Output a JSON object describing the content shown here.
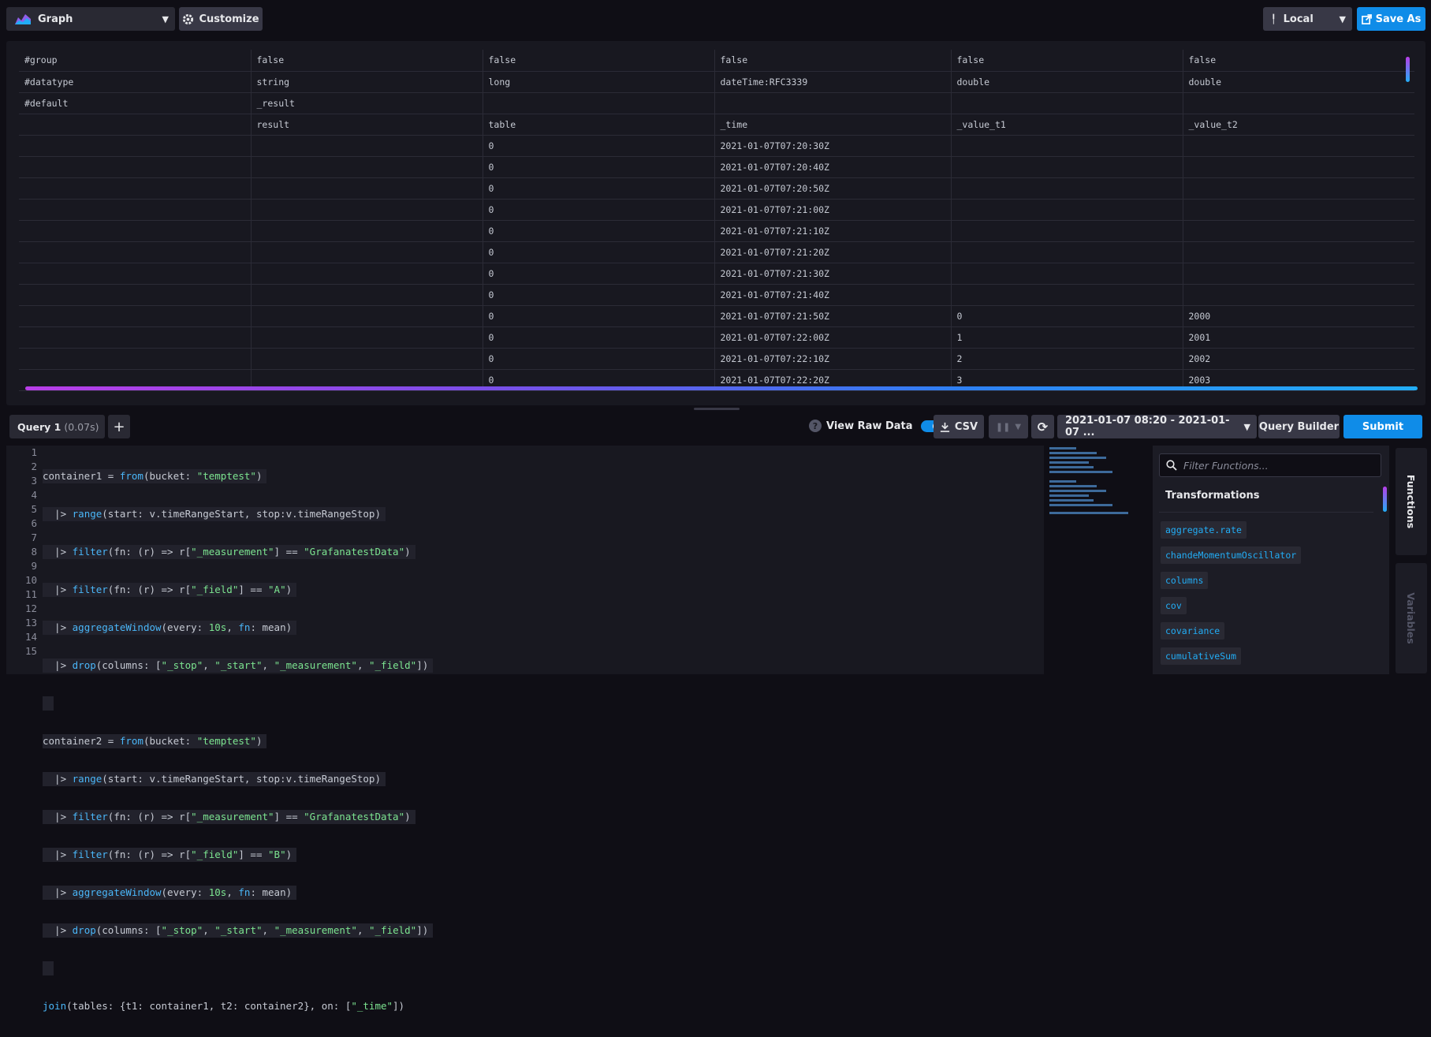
{
  "toolbar": {
    "vis_type": "Graph",
    "customize_label": "Customize",
    "timezone": "Local",
    "save_as_label": "Save As"
  },
  "raw_table": {
    "rows": [
      [
        "#group",
        "false",
        "false",
        "false",
        "false",
        "false"
      ],
      [
        "#datatype",
        "string",
        "long",
        "dateTime:RFC3339",
        "double",
        "double"
      ],
      [
        "#default",
        "_result",
        "",
        "",
        "",
        ""
      ],
      [
        "",
        "result",
        "table",
        "_time",
        "_value_t1",
        "_value_t2"
      ],
      [
        "",
        "",
        "0",
        "2021-01-07T07:20:30Z",
        "",
        ""
      ],
      [
        "",
        "",
        "0",
        "2021-01-07T07:20:40Z",
        "",
        ""
      ],
      [
        "",
        "",
        "0",
        "2021-01-07T07:20:50Z",
        "",
        ""
      ],
      [
        "",
        "",
        "0",
        "2021-01-07T07:21:00Z",
        "",
        ""
      ],
      [
        "",
        "",
        "0",
        "2021-01-07T07:21:10Z",
        "",
        ""
      ],
      [
        "",
        "",
        "0",
        "2021-01-07T07:21:20Z",
        "",
        ""
      ],
      [
        "",
        "",
        "0",
        "2021-01-07T07:21:30Z",
        "",
        ""
      ],
      [
        "",
        "",
        "0",
        "2021-01-07T07:21:40Z",
        "",
        ""
      ],
      [
        "",
        "",
        "0",
        "2021-01-07T07:21:50Z",
        "0",
        "2000"
      ],
      [
        "",
        "",
        "0",
        "2021-01-07T07:22:00Z",
        "1",
        "2001"
      ],
      [
        "",
        "",
        "0",
        "2021-01-07T07:22:10Z",
        "2",
        "2002"
      ],
      [
        "",
        "",
        "0",
        "2021-01-07T07:22:20Z",
        "3",
        "2003"
      ]
    ]
  },
  "query_bar": {
    "tab_label": "Query 1",
    "tab_time": "(0.07s)",
    "add_label": "+",
    "view_raw_label": "View Raw Data",
    "csv_label": "CSV",
    "time_range": "2021-01-07 08:20 - 2021-01-07 ...",
    "query_builder_label": "Query Builder",
    "submit_label": "Submit"
  },
  "editor": {
    "line_numbers": [
      "1",
      "2",
      "3",
      "4",
      "5",
      "6",
      "7",
      "8",
      "9",
      "10",
      "11",
      "12",
      "13",
      "14",
      "15"
    ]
  },
  "functions_panel": {
    "filter_placeholder": "Filter Functions...",
    "section_title": "Transformations",
    "items": [
      "aggregate.rate",
      "chandeMomentumOscillator",
      "columns",
      "cov",
      "covariance",
      "cumulativeSum"
    ],
    "tab_functions": "Functions",
    "tab_variables": "Variables"
  }
}
